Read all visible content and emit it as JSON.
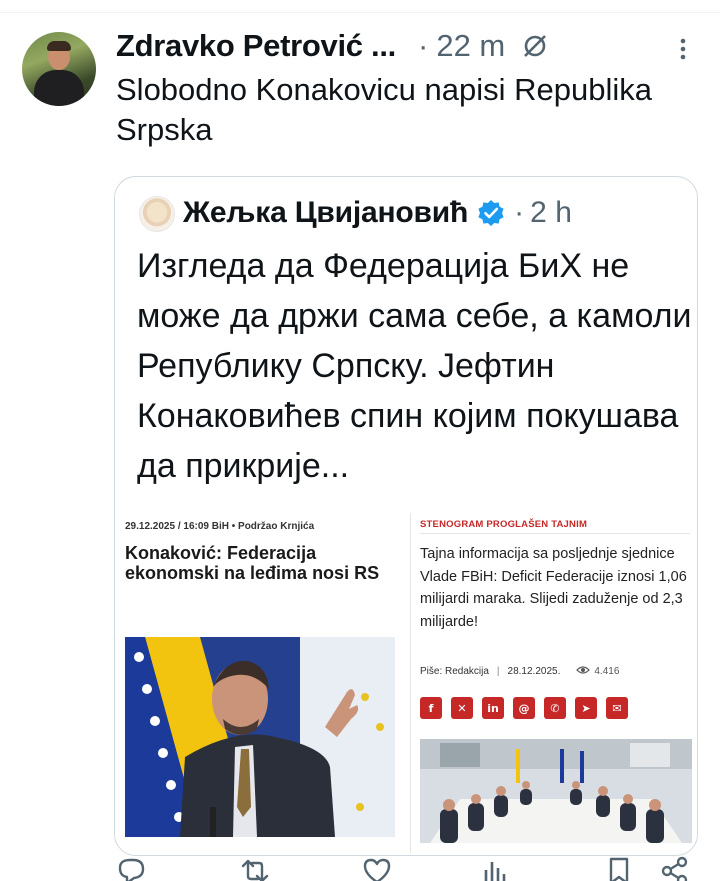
{
  "tweet": {
    "author": "Zdravko Petrović ...",
    "separator": "·",
    "time": "22 m",
    "text": "Slobodno Konakovicu napisi Republika Srpska",
    "icons": {
      "mute": "mute-icon",
      "more": "more-icon"
    }
  },
  "quote": {
    "author": "Жељка Цвијановић",
    "verified": true,
    "separator": "·",
    "time": "2 h",
    "text": "Изгледа да Федерација БиХ не може да држи сама себе, а камоли Републику Српску. Јефтин Конаковићев спин којим покушава да прикрије...",
    "image": {
      "left_article": {
        "meta": "29.12.2025 / 16:09 BiH • Podržao Krnjića",
        "title": "Konaković: Federacija ekonomski na leđima nosi RS"
      },
      "right_article": {
        "tag": "STENOGRAM PROGLAŠEN TAJNIM",
        "title": "Tajna informacija sa posljednje sjednice Vlade FBiH: Deficit Federacije iznosi 1,06 milijardi maraka. Slijedi zaduženje od 2,3 milijarde!",
        "author": "Piše: Redakcija",
        "meta_sep": "|",
        "date": "28.12.2025.",
        "views": "4.416",
        "share_icons": [
          "facebook-icon",
          "x-icon",
          "linkedin-icon",
          "threads-icon",
          "whatsapp-icon",
          "telegram-icon",
          "email-icon"
        ]
      }
    }
  },
  "actions": {
    "icons": [
      "reply-icon",
      "retweet-icon",
      "like-icon",
      "views-icon",
      "bookmark-icon",
      "share-icon"
    ]
  },
  "colors": {
    "text": "#0f1419",
    "muted": "#536471",
    "verified": "#1d9bf0",
    "accent_red": "#c62828",
    "border": "#cfd9de"
  }
}
